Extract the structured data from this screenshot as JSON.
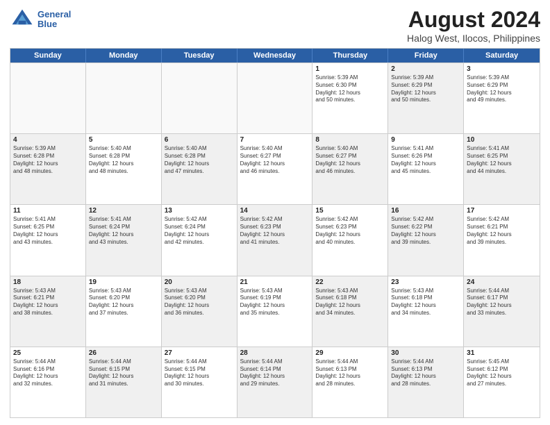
{
  "logo": {
    "line1": "General",
    "line2": "Blue"
  },
  "title": "August 2024",
  "subtitle": "Halog West, Ilocos, Philippines",
  "weekdays": [
    "Sunday",
    "Monday",
    "Tuesday",
    "Wednesday",
    "Thursday",
    "Friday",
    "Saturday"
  ],
  "rows": [
    [
      {
        "day": "",
        "info": "",
        "shaded": false,
        "empty": true
      },
      {
        "day": "",
        "info": "",
        "shaded": false,
        "empty": true
      },
      {
        "day": "",
        "info": "",
        "shaded": false,
        "empty": true
      },
      {
        "day": "",
        "info": "",
        "shaded": false,
        "empty": true
      },
      {
        "day": "1",
        "info": "Sunrise: 5:39 AM\nSunset: 6:30 PM\nDaylight: 12 hours\nand 50 minutes.",
        "shaded": false,
        "empty": false
      },
      {
        "day": "2",
        "info": "Sunrise: 5:39 AM\nSunset: 6:29 PM\nDaylight: 12 hours\nand 50 minutes.",
        "shaded": true,
        "empty": false
      },
      {
        "day": "3",
        "info": "Sunrise: 5:39 AM\nSunset: 6:29 PM\nDaylight: 12 hours\nand 49 minutes.",
        "shaded": false,
        "empty": false
      }
    ],
    [
      {
        "day": "4",
        "info": "Sunrise: 5:39 AM\nSunset: 6:28 PM\nDaylight: 12 hours\nand 48 minutes.",
        "shaded": true,
        "empty": false
      },
      {
        "day": "5",
        "info": "Sunrise: 5:40 AM\nSunset: 6:28 PM\nDaylight: 12 hours\nand 48 minutes.",
        "shaded": false,
        "empty": false
      },
      {
        "day": "6",
        "info": "Sunrise: 5:40 AM\nSunset: 6:28 PM\nDaylight: 12 hours\nand 47 minutes.",
        "shaded": true,
        "empty": false
      },
      {
        "day": "7",
        "info": "Sunrise: 5:40 AM\nSunset: 6:27 PM\nDaylight: 12 hours\nand 46 minutes.",
        "shaded": false,
        "empty": false
      },
      {
        "day": "8",
        "info": "Sunrise: 5:40 AM\nSunset: 6:27 PM\nDaylight: 12 hours\nand 46 minutes.",
        "shaded": true,
        "empty": false
      },
      {
        "day": "9",
        "info": "Sunrise: 5:41 AM\nSunset: 6:26 PM\nDaylight: 12 hours\nand 45 minutes.",
        "shaded": false,
        "empty": false
      },
      {
        "day": "10",
        "info": "Sunrise: 5:41 AM\nSunset: 6:25 PM\nDaylight: 12 hours\nand 44 minutes.",
        "shaded": true,
        "empty": false
      }
    ],
    [
      {
        "day": "11",
        "info": "Sunrise: 5:41 AM\nSunset: 6:25 PM\nDaylight: 12 hours\nand 43 minutes.",
        "shaded": false,
        "empty": false
      },
      {
        "day": "12",
        "info": "Sunrise: 5:41 AM\nSunset: 6:24 PM\nDaylight: 12 hours\nand 43 minutes.",
        "shaded": true,
        "empty": false
      },
      {
        "day": "13",
        "info": "Sunrise: 5:42 AM\nSunset: 6:24 PM\nDaylight: 12 hours\nand 42 minutes.",
        "shaded": false,
        "empty": false
      },
      {
        "day": "14",
        "info": "Sunrise: 5:42 AM\nSunset: 6:23 PM\nDaylight: 12 hours\nand 41 minutes.",
        "shaded": true,
        "empty": false
      },
      {
        "day": "15",
        "info": "Sunrise: 5:42 AM\nSunset: 6:23 PM\nDaylight: 12 hours\nand 40 minutes.",
        "shaded": false,
        "empty": false
      },
      {
        "day": "16",
        "info": "Sunrise: 5:42 AM\nSunset: 6:22 PM\nDaylight: 12 hours\nand 39 minutes.",
        "shaded": true,
        "empty": false
      },
      {
        "day": "17",
        "info": "Sunrise: 5:42 AM\nSunset: 6:21 PM\nDaylight: 12 hours\nand 39 minutes.",
        "shaded": false,
        "empty": false
      }
    ],
    [
      {
        "day": "18",
        "info": "Sunrise: 5:43 AM\nSunset: 6:21 PM\nDaylight: 12 hours\nand 38 minutes.",
        "shaded": true,
        "empty": false
      },
      {
        "day": "19",
        "info": "Sunrise: 5:43 AM\nSunset: 6:20 PM\nDaylight: 12 hours\nand 37 minutes.",
        "shaded": false,
        "empty": false
      },
      {
        "day": "20",
        "info": "Sunrise: 5:43 AM\nSunset: 6:20 PM\nDaylight: 12 hours\nand 36 minutes.",
        "shaded": true,
        "empty": false
      },
      {
        "day": "21",
        "info": "Sunrise: 5:43 AM\nSunset: 6:19 PM\nDaylight: 12 hours\nand 35 minutes.",
        "shaded": false,
        "empty": false
      },
      {
        "day": "22",
        "info": "Sunrise: 5:43 AM\nSunset: 6:18 PM\nDaylight: 12 hours\nand 34 minutes.",
        "shaded": true,
        "empty": false
      },
      {
        "day": "23",
        "info": "Sunrise: 5:43 AM\nSunset: 6:18 PM\nDaylight: 12 hours\nand 34 minutes.",
        "shaded": false,
        "empty": false
      },
      {
        "day": "24",
        "info": "Sunrise: 5:44 AM\nSunset: 6:17 PM\nDaylight: 12 hours\nand 33 minutes.",
        "shaded": true,
        "empty": false
      }
    ],
    [
      {
        "day": "25",
        "info": "Sunrise: 5:44 AM\nSunset: 6:16 PM\nDaylight: 12 hours\nand 32 minutes.",
        "shaded": false,
        "empty": false
      },
      {
        "day": "26",
        "info": "Sunrise: 5:44 AM\nSunset: 6:15 PM\nDaylight: 12 hours\nand 31 minutes.",
        "shaded": true,
        "empty": false
      },
      {
        "day": "27",
        "info": "Sunrise: 5:44 AM\nSunset: 6:15 PM\nDaylight: 12 hours\nand 30 minutes.",
        "shaded": false,
        "empty": false
      },
      {
        "day": "28",
        "info": "Sunrise: 5:44 AM\nSunset: 6:14 PM\nDaylight: 12 hours\nand 29 minutes.",
        "shaded": true,
        "empty": false
      },
      {
        "day": "29",
        "info": "Sunrise: 5:44 AM\nSunset: 6:13 PM\nDaylight: 12 hours\nand 28 minutes.",
        "shaded": false,
        "empty": false
      },
      {
        "day": "30",
        "info": "Sunrise: 5:44 AM\nSunset: 6:13 PM\nDaylight: 12 hours\nand 28 minutes.",
        "shaded": true,
        "empty": false
      },
      {
        "day": "31",
        "info": "Sunrise: 5:45 AM\nSunset: 6:12 PM\nDaylight: 12 hours\nand 27 minutes.",
        "shaded": false,
        "empty": false
      }
    ]
  ]
}
